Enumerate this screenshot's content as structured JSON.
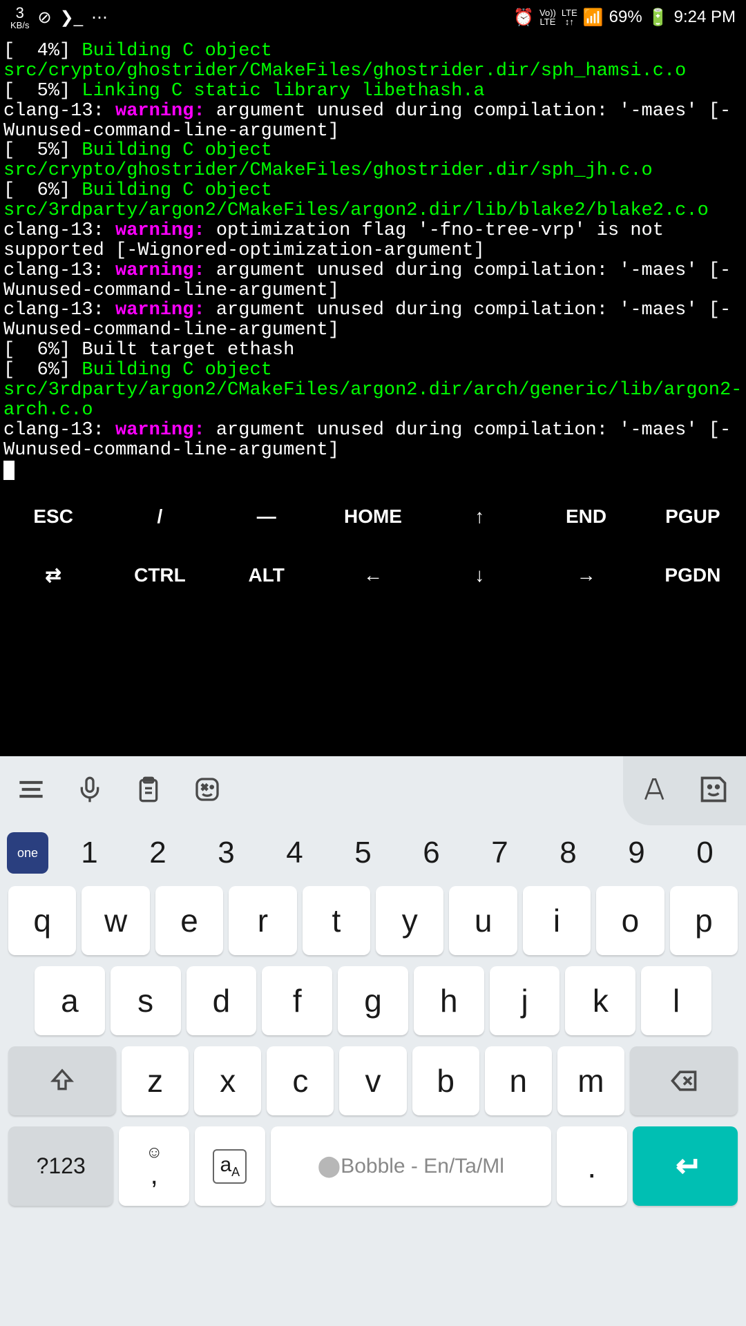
{
  "status_bar": {
    "kbs_num": "3",
    "kbs_label": "KB/s",
    "alarm_icon": "⏰",
    "volte": "Vo))",
    "lte": "LTE",
    "lte_arrows": "↕↑",
    "signal": "📶",
    "battery_pct": "69%",
    "time": "9:24 PM"
  },
  "terminal_lines": [
    {
      "segments": [
        {
          "text": "[  4%] ",
          "class": ""
        },
        {
          "text": "Building C object src/crypto/ghostrider/CMakeFiles/ghostrider.dir/sph_hamsi.c.o",
          "class": "green"
        }
      ]
    },
    {
      "segments": [
        {
          "text": "[  5%] ",
          "class": ""
        },
        {
          "text": "Linking C static library libethash.a",
          "class": "green bold"
        }
      ]
    },
    {
      "segments": [
        {
          "text": "clang-13: ",
          "class": ""
        },
        {
          "text": "warning: ",
          "class": "magenta"
        },
        {
          "text": "argument unused during compilation: '-maes' [-Wunused-command-line-argument]",
          "class": ""
        }
      ]
    },
    {
      "segments": [
        {
          "text": "[  5%] ",
          "class": ""
        },
        {
          "text": "Building C object src/crypto/ghostrider/CMakeFiles/ghostrider.dir/sph_jh.c.o",
          "class": "green"
        }
      ]
    },
    {
      "segments": [
        {
          "text": "[  6%] ",
          "class": ""
        },
        {
          "text": "Building C object src/3rdparty/argon2/CMakeFiles/argon2.dir/lib/blake2/blake2.c.o",
          "class": "green"
        }
      ]
    },
    {
      "segments": [
        {
          "text": "clang-13: ",
          "class": ""
        },
        {
          "text": "warning: ",
          "class": "magenta"
        },
        {
          "text": "optimization flag '-fno-tree-vrp' is not supported [-Wignored-optimization-argument]",
          "class": ""
        }
      ]
    },
    {
      "segments": [
        {
          "text": "clang-13: ",
          "class": ""
        },
        {
          "text": "warning: ",
          "class": "magenta"
        },
        {
          "text": "argument unused during compilation: '-maes' [-Wunused-command-line-argument]",
          "class": ""
        }
      ]
    },
    {
      "segments": [
        {
          "text": "clang-13: ",
          "class": ""
        },
        {
          "text": "warning: ",
          "class": "magenta"
        },
        {
          "text": "argument unused during compilation: '-maes' [-Wunused-command-line-argument]",
          "class": ""
        }
      ]
    },
    {
      "segments": [
        {
          "text": "[  6%] Built target ethash",
          "class": ""
        }
      ]
    },
    {
      "segments": [
        {
          "text": "[  6%] ",
          "class": ""
        },
        {
          "text": "Building C object src/3rdparty/argon2/CMakeFiles/argon2.dir/arch/generic/lib/argon2-arch.c.o",
          "class": "green"
        }
      ]
    },
    {
      "segments": [
        {
          "text": "clang-13: ",
          "class": ""
        },
        {
          "text": "warning: ",
          "class": "magenta"
        },
        {
          "text": "argument unused during compilation: '-maes' [-Wunused-command-line-argument]",
          "class": ""
        }
      ]
    }
  ],
  "fn_keys": {
    "row1": [
      "ESC",
      "/",
      "―",
      "HOME",
      "↑",
      "END",
      "PGUP"
    ],
    "row2": [
      "⇄",
      "CTRL",
      "ALT",
      "←",
      "↓",
      "→",
      "PGDN"
    ]
  },
  "nums": [
    "1",
    "2",
    "3",
    "4",
    "5",
    "6",
    "7",
    "8",
    "9",
    "0"
  ],
  "row_q": [
    "q",
    "w",
    "e",
    "r",
    "t",
    "y",
    "u",
    "i",
    "o",
    "p"
  ],
  "row_a": [
    "a",
    "s",
    "d",
    "f",
    "g",
    "h",
    "j",
    "k",
    "l"
  ],
  "row_z": [
    "z",
    "x",
    "c",
    "v",
    "b",
    "n",
    "m"
  ],
  "bobble_badge": "one",
  "sym_key": "?123",
  "bobble_text": "Bobble - En/Ta/Ml",
  "period": "."
}
